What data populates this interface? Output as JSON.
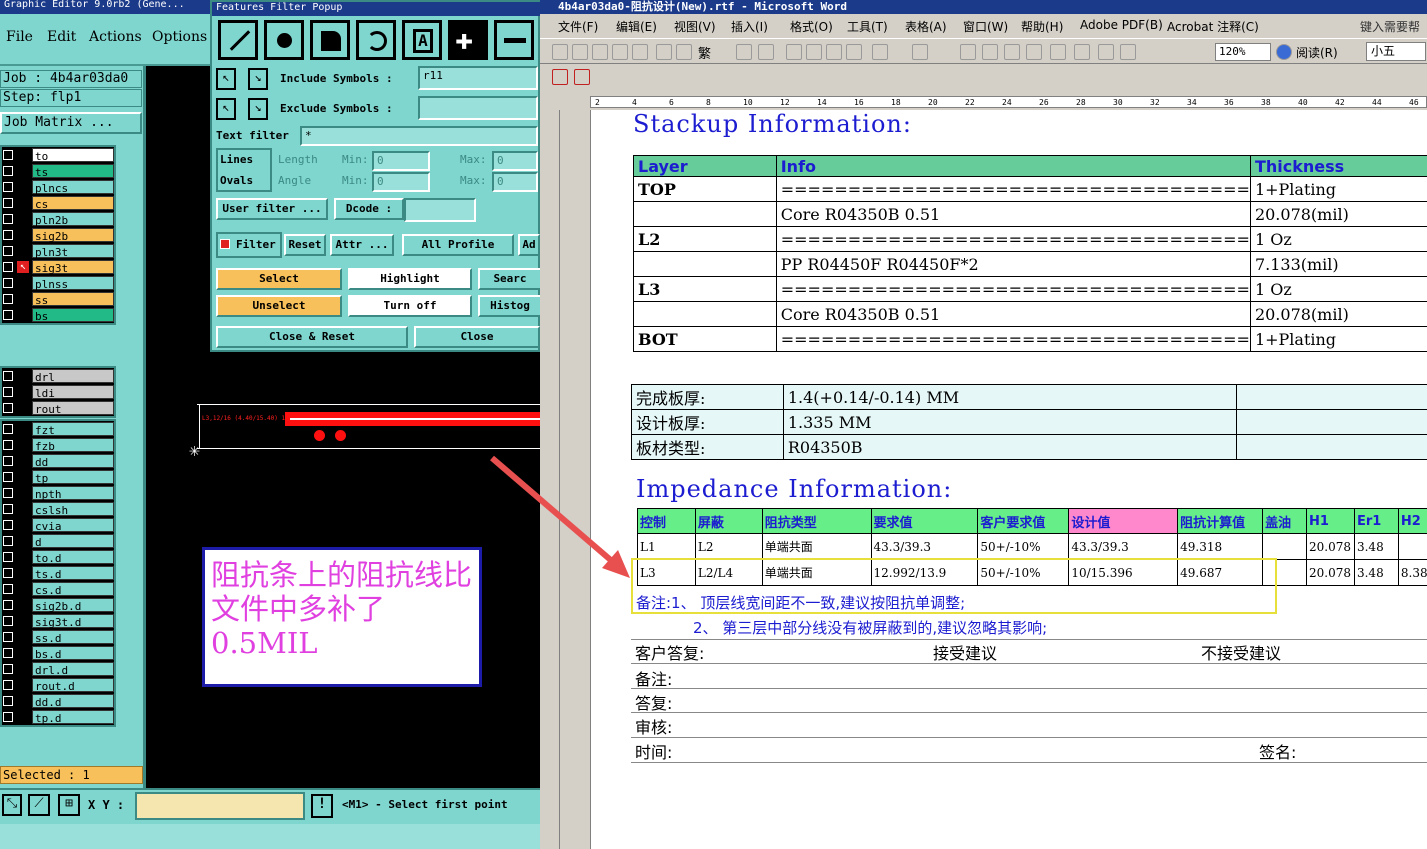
{
  "genesis": {
    "title": "Graphic Editor 9.0rb2 (Gene...",
    "menu": [
      "File",
      "Edit",
      "Actions",
      "Options"
    ],
    "job_label": "Job : 4b4ar03da0",
    "step_label": "Step: flp1",
    "job_matrix": "Job Matrix ...",
    "layers_group1": [
      {
        "name": "to",
        "color": "#ffffff"
      },
      {
        "name": "ts",
        "color": "#22bb88"
      },
      {
        "name": "plncs",
        "color": "#7fd6cf"
      },
      {
        "name": "cs",
        "color": "#f7c05a"
      },
      {
        "name": "pln2b",
        "color": "#7fd6cf"
      },
      {
        "name": "sig2b",
        "color": "#f7c05a"
      },
      {
        "name": "pln3t",
        "color": "#7fd6cf"
      },
      {
        "name": "sig3t",
        "color": "#f7c05a"
      },
      {
        "name": "plnss",
        "color": "#7fd6cf"
      },
      {
        "name": "ss",
        "color": "#f7c05a"
      },
      {
        "name": "bs",
        "color": "#22bb88"
      }
    ],
    "layers_group2": [
      {
        "name": "drl",
        "color": "#c8c8c8"
      },
      {
        "name": "ldi",
        "color": "#c8c8c8"
      },
      {
        "name": "rout",
        "color": "#c8c8c8"
      }
    ],
    "layers_group3": [
      {
        "name": "fzt"
      },
      {
        "name": "fzb"
      },
      {
        "name": "dd"
      },
      {
        "name": "tp"
      },
      {
        "name": "npth"
      },
      {
        "name": "cslsh"
      },
      {
        "name": "cvia"
      },
      {
        "name": "d"
      },
      {
        "name": "to.d"
      },
      {
        "name": "ts.d"
      },
      {
        "name": "cs.d"
      },
      {
        "name": "sig2b.d"
      },
      {
        "name": "sig3t.d"
      },
      {
        "name": "ss.d"
      },
      {
        "name": "bs.d"
      },
      {
        "name": "drl.d"
      },
      {
        "name": "rout.d"
      },
      {
        "name": "dd.d"
      },
      {
        "name": "tp.d"
      }
    ],
    "selected": "Selected : 1",
    "xy_label": "X Y :",
    "prompt": "<M1> - Select first point",
    "canvas_annotation": "阻抗条上的阻抗线比文件中多补了0.5MIL",
    "canvas_label": "L3,12/16 (4.40/15.40) 1"
  },
  "popup": {
    "title": "Features Filter Popup",
    "include_label": "Include Symbols :",
    "include_value": "r11",
    "exclude_label": "Exclude Symbols :",
    "exclude_value": "",
    "text_filter_label": "Text filter",
    "text_filter_value": "*",
    "lines": "Lines",
    "ovals": "Ovals",
    "length": "Length",
    "angle": "Angle",
    "min": "Min:",
    "max": "Max:",
    "zero": "0",
    "user_filter": "User filter ...",
    "dcode": "Dcode :",
    "filter": "Filter",
    "reset": "Reset",
    "attr": "Attr ...",
    "all_profile": "All Profile",
    "ad": "Ad",
    "select": "Select",
    "highlight": "Highlight",
    "search": "Searc",
    "unselect": "Unselect",
    "turn_off": "Turn off",
    "histo": "Histog",
    "close_reset": "Close & Reset",
    "close": "Close"
  },
  "word": {
    "title": "4b4ar03da0-阻抗设计(New).rtf - Microsoft Word",
    "menu": [
      "文件(F)",
      "编辑(E)",
      "视图(V)",
      "插入(I)",
      "格式(O)",
      "工具(T)",
      "表格(A)",
      "窗口(W)",
      "帮助(H)",
      "Adobe PDF(B)",
      "Acrobat 注释(C)"
    ],
    "help_hint": "键入需要帮",
    "zoom": "120%",
    "font_size": "小五",
    "read_btn": "阅读(R)",
    "fanti": "繁",
    "stackup_title": "Stackup Information:",
    "stackup_headers": [
      "Layer",
      "Info",
      "Thickness"
    ],
    "stackup_rows": [
      [
        "TOP",
        "===================================",
        "1+Plating"
      ],
      [
        "",
        "Core      R04350B     0.51",
        "20.078(mil)"
      ],
      [
        "L2",
        "===================================",
        "1 Oz"
      ],
      [
        "",
        "PP     R04450F     R04450F*2",
        "7.133(mil)"
      ],
      [
        "L3",
        "===================================",
        "1 Oz"
      ],
      [
        "",
        "Core      R04350B     0.51",
        "20.078(mil)"
      ],
      [
        "BOT",
        "===================================",
        "1+Plating"
      ]
    ],
    "board_rows": [
      [
        "完成板厚:",
        "1.4(+0.14/-0.14) MM",
        ""
      ],
      [
        "设计板厚:",
        "1.335 MM",
        ""
      ],
      [
        "板材类型:",
        "R04350B",
        ""
      ]
    ],
    "impedance_title": "Impedance Information:",
    "imp_headers": [
      "控制",
      "屏蔽",
      "阻抗类型",
      "要求值",
      "客户要求值",
      "设计值",
      "阻抗计算值",
      "盖油",
      "H1",
      "Er1",
      "H2"
    ],
    "imp_rows": [
      [
        "L1",
        "L2",
        "单端共面",
        "43.3/39.3",
        "50+/-10%",
        "43.3/39.3",
        "49.318",
        "",
        "20.078",
        "3.48",
        ""
      ],
      [
        "L3",
        "L2/L4",
        "单端共面",
        "12.992/13.9",
        "50+/-10%",
        "10/15.396",
        "49.687",
        "",
        "20.078",
        "3.48",
        "8.38"
      ]
    ],
    "note1": "备注:1、 顶层线宽间距不一致,建议按阻抗单调整;",
    "note2": "2、 第三层中部分线没有被屏蔽到的,建议忽略其影响;",
    "customer_reply": "客户答复:",
    "accept": "接受建议",
    "not_accept": "不接受建议",
    "remark": "备注:",
    "reply": "答复:",
    "review": "审核:",
    "time": "时间:",
    "sign": "签名:",
    "ruler_marks": [
      "2",
      "4",
      "6",
      "8",
      "10",
      "12",
      "14",
      "16",
      "18",
      "20",
      "22",
      "24",
      "26",
      "28",
      "30",
      "32",
      "34",
      "36",
      "38",
      "40",
      "42",
      "44",
      "46"
    ]
  }
}
